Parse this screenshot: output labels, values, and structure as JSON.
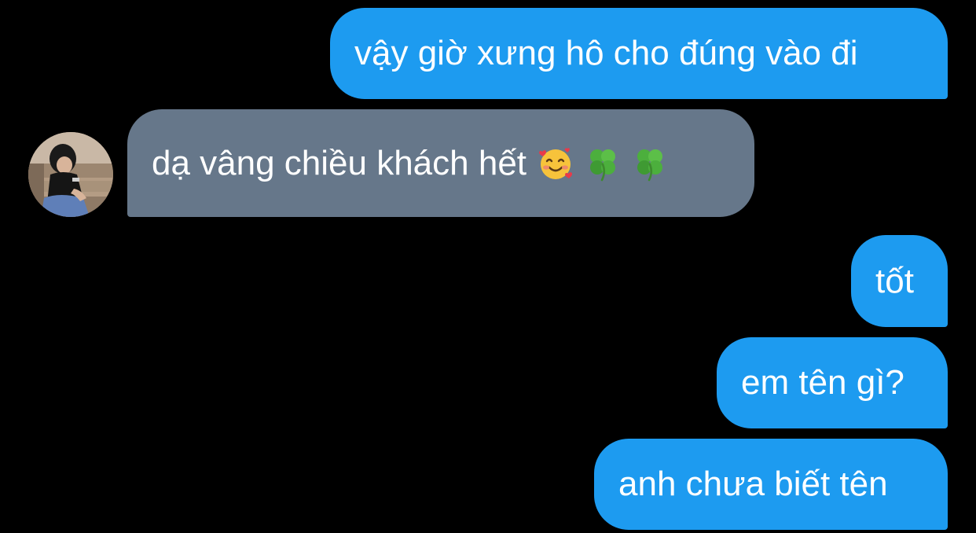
{
  "messages": [
    {
      "direction": "outgoing",
      "text": "vậy giờ xưng hô cho đúng vào đi"
    },
    {
      "direction": "incoming",
      "text": "dạ vâng chiều khách hết",
      "emojis": [
        "smiling-face-with-hearts-icon",
        "four-leaf-clover-icon",
        "four-leaf-clover-icon"
      ]
    },
    {
      "direction": "outgoing",
      "text": "tốt"
    },
    {
      "direction": "outgoing",
      "text": "em tên gì?"
    },
    {
      "direction": "outgoing",
      "text": "anh chưa biết tên"
    }
  ],
  "colors": {
    "background": "#000000",
    "outgoing_bubble": "#1d9bf0",
    "incoming_bubble": "#66778a",
    "text": "#ffffff"
  },
  "sender": {
    "avatar": "avatar"
  }
}
